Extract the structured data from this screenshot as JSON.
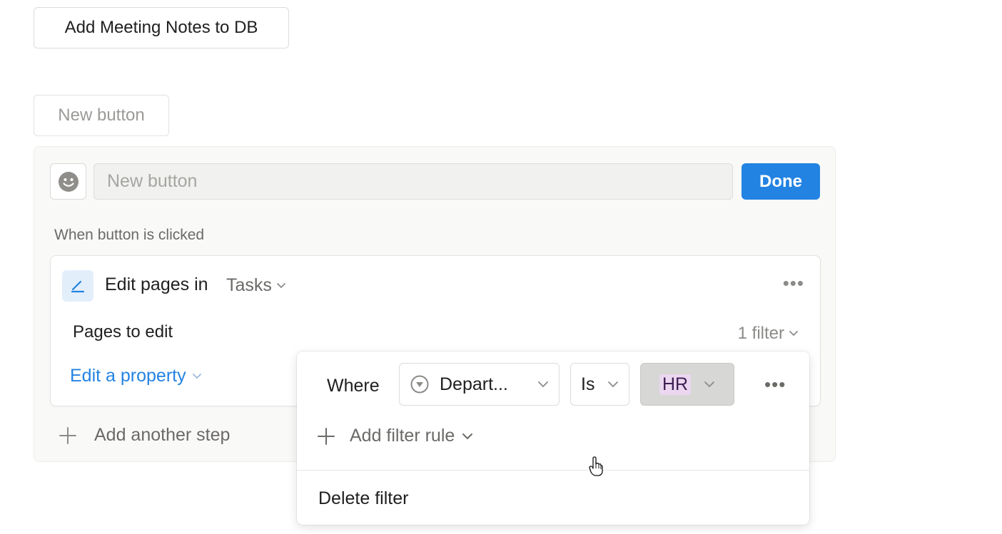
{
  "top_button": {
    "label": "Add Meeting Notes to DB"
  },
  "new_button": {
    "label": "New button"
  },
  "editor": {
    "name_input": {
      "placeholder": "New button",
      "value": ""
    },
    "done_label": "Done",
    "when_label": "When button is clicked",
    "step": {
      "title": "Edit pages in",
      "database": "Tasks",
      "pages_label": "Pages to edit",
      "filter_count": "1 filter",
      "edit_property": "Edit a property"
    },
    "add_step_label": "Add another step"
  },
  "filter_popup": {
    "where_label": "Where",
    "property": "Depart...",
    "operator": "Is",
    "value": "HR",
    "add_rule_label": "Add filter rule",
    "delete_label": "Delete filter"
  },
  "colors": {
    "accent": "#2383e2",
    "value_tag_bg": "#ebd7f0",
    "value_tag_text": "#3e1f52"
  },
  "icons": {
    "emoji": "smiley-icon",
    "step": "pencil-edit-icon",
    "property_type": "select-type-icon",
    "more": "more-horizontal-icon",
    "plus": "plus-icon",
    "chevron": "chevron-down-icon",
    "cursor": "hand-cursor-icon"
  }
}
